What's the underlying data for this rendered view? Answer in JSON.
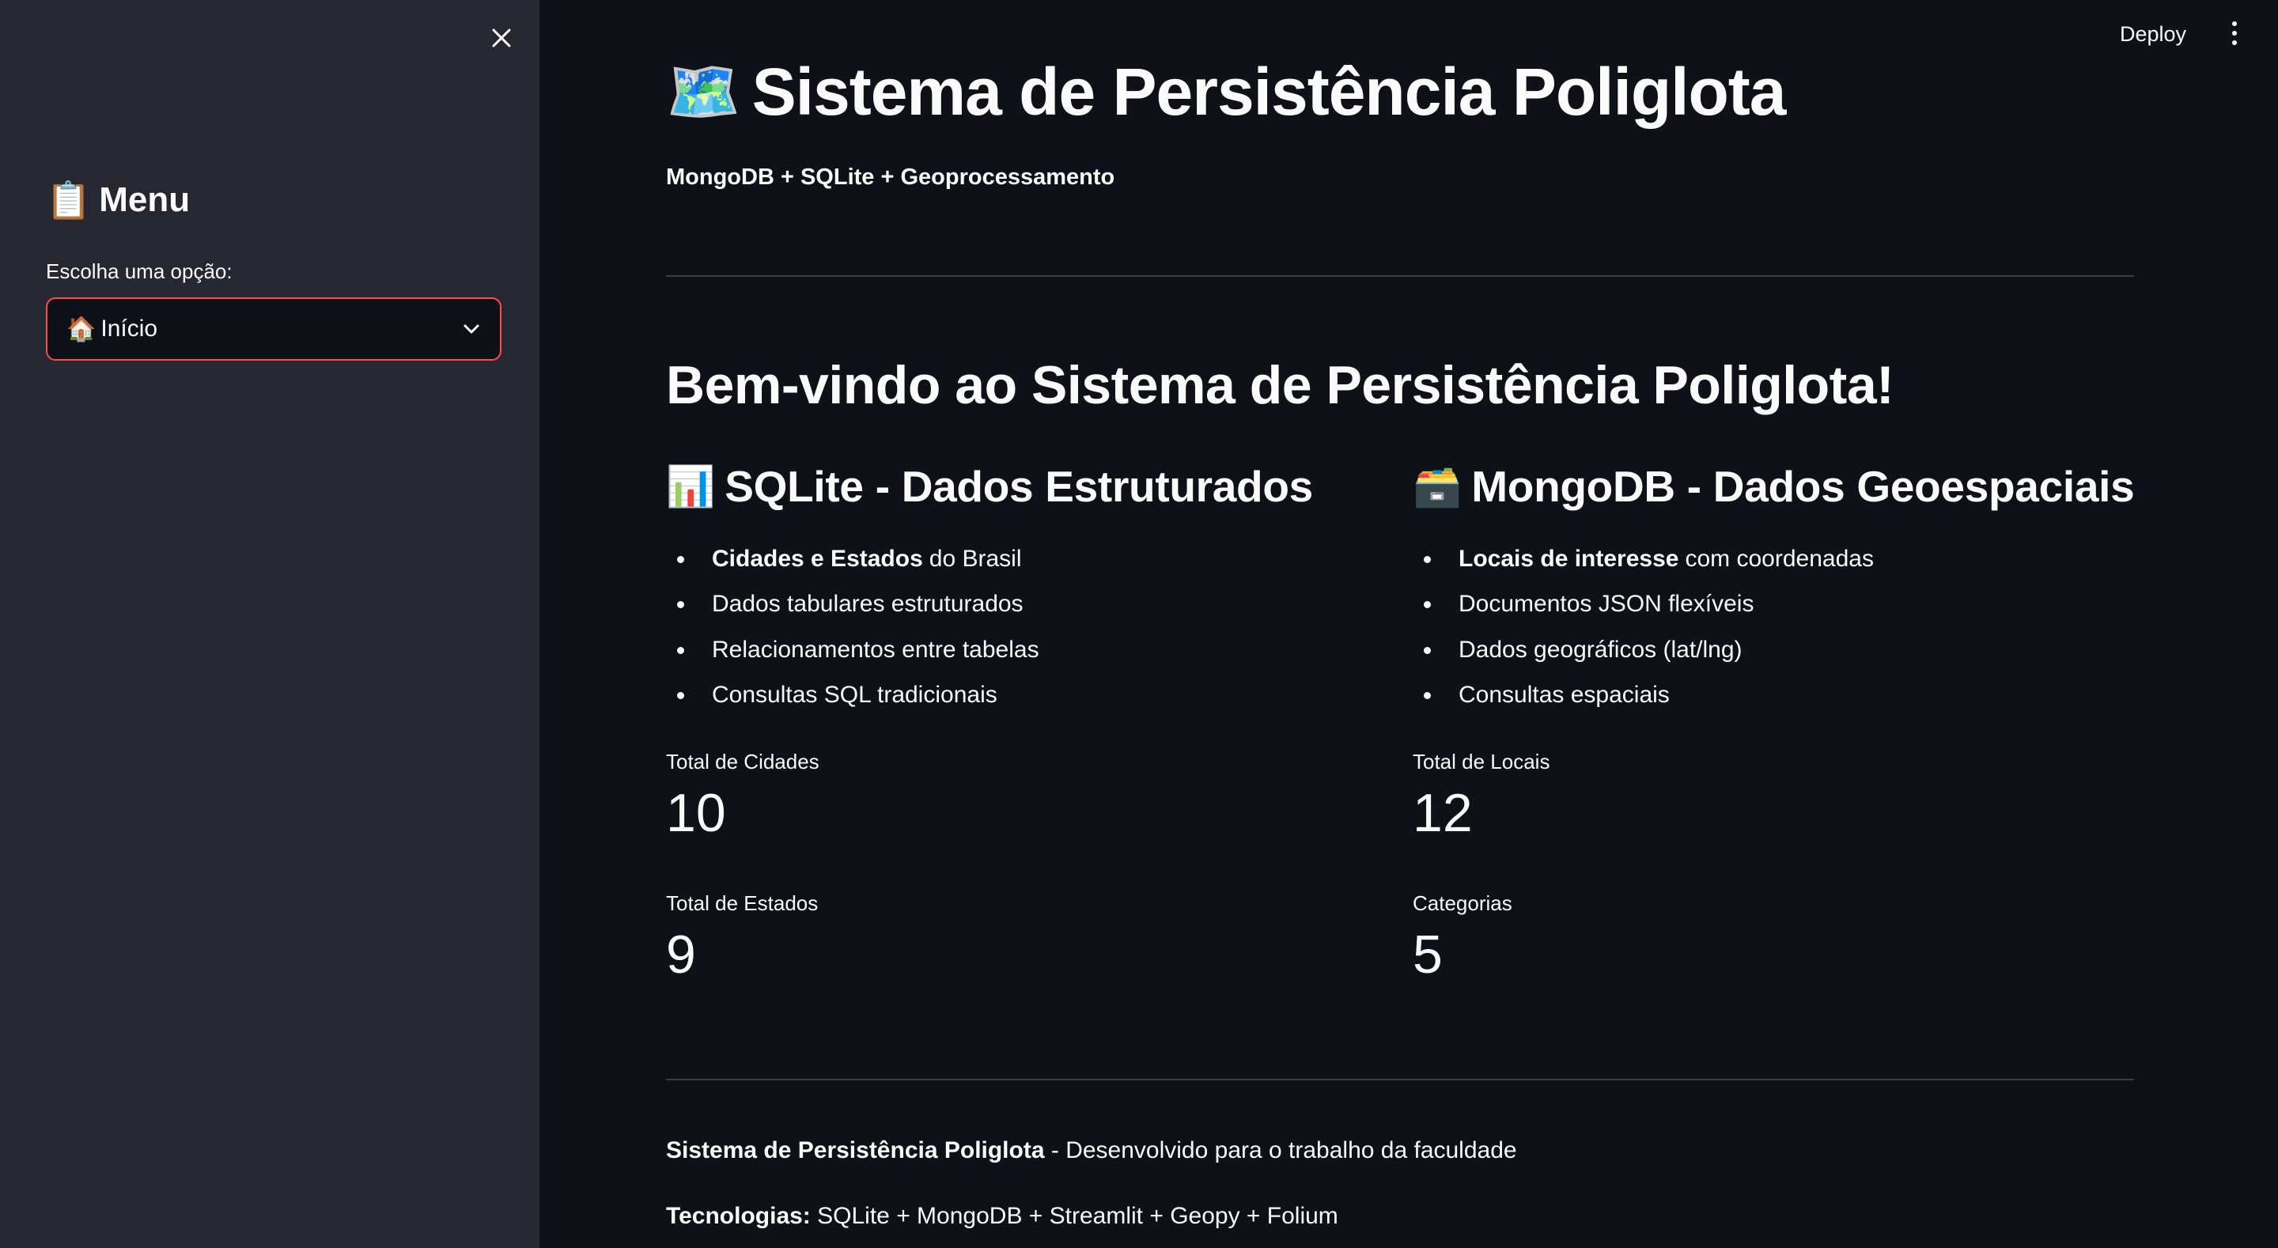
{
  "sidebar": {
    "title_emoji": "📋",
    "title": "Menu",
    "select_label": "Escolha uma opção:",
    "select_emoji": "🏠",
    "select_value": "Início",
    "accent": "#ff4b4b"
  },
  "topbar": {
    "deploy_label": "Deploy"
  },
  "header": {
    "emoji": "🗺️",
    "title": "Sistema de Persistência Poliglota",
    "subtitle": "MongoDB + SQLite + Geoprocessamento"
  },
  "welcome": "Bem-vindo ao Sistema de Persistência Poliglota!",
  "sqlite": {
    "emoji": "📊",
    "title": "SQLite - Dados Estruturados",
    "bullets": [
      {
        "bold": "Cidades e Estados",
        "text": "do Brasil"
      },
      {
        "bold": "",
        "text": "Dados tabulares estruturados"
      },
      {
        "bold": "",
        "text": "Relacionamentos entre tabelas"
      },
      {
        "bold": "",
        "text": "Consultas SQL tradicionais"
      }
    ],
    "metrics": [
      {
        "label": "Total de Cidades",
        "value": "10"
      },
      {
        "label": "Total de Estados",
        "value": "9"
      }
    ]
  },
  "mongodb": {
    "emoji": "🗃️",
    "title": "MongoDB - Dados Geoespaciais",
    "bullets": [
      {
        "bold": "Locais de interesse",
        "text": "com coordenadas"
      },
      {
        "bold": "",
        "text": "Documentos JSON flexíveis"
      },
      {
        "bold": "",
        "text": "Dados geográficos (lat/lng)"
      },
      {
        "bold": "",
        "text": "Consultas espaciais"
      }
    ],
    "metrics": [
      {
        "label": "Total de Locais",
        "value": "12"
      },
      {
        "label": "Categorias",
        "value": "5"
      }
    ]
  },
  "footer": {
    "line1_bold": "Sistema de Persistência Poliglota",
    "line1_text": " - Desenvolvido para o trabalho da faculdade",
    "line2_bold": "Tecnologias:",
    "line2_text": " SQLite + MongoDB + Streamlit + Geopy + Folium"
  }
}
